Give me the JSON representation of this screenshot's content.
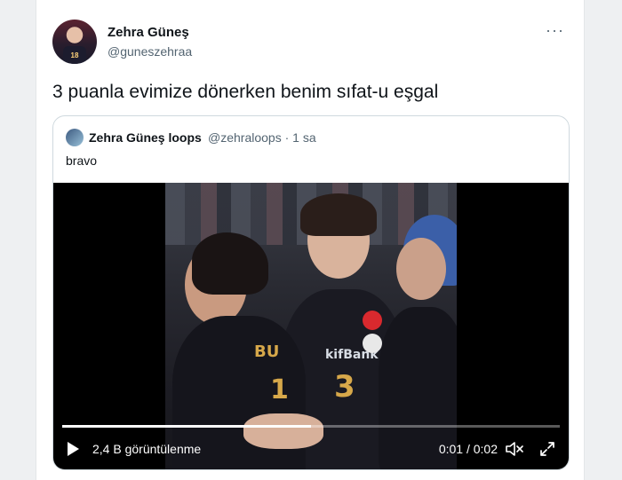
{
  "tweet": {
    "author_name": "Zehra Güneş",
    "author_handle": "@guneszehraa",
    "more_label": "···",
    "text": "3 puanla evimize dönerken benim sıfat-u eşgal",
    "avatar_number": "18"
  },
  "quoted": {
    "author_name": "Zehra Güneş loops",
    "meta": "@zehraloops · 1 sa",
    "text": "bravo"
  },
  "video": {
    "views": "2,4 B görüntülenme",
    "time": "0:01 / 0:02",
    "progress": 0.5,
    "jersey_left": "BU",
    "jersey_left_number": "1",
    "jersey_center_number": "3",
    "sponsor": "kifBank"
  },
  "colors": {
    "text_primary": "#0f1419",
    "text_secondary": "#536471",
    "border": "#cfd9de"
  }
}
